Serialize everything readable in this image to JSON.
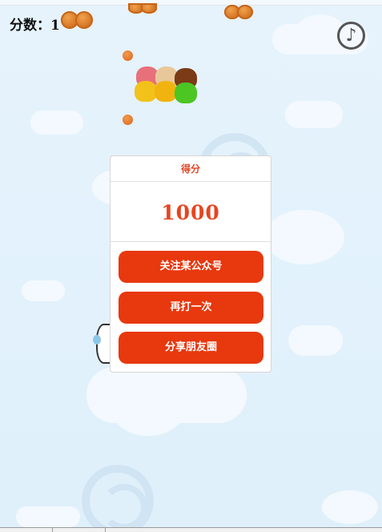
{
  "hud": {
    "score_label": "分数：",
    "score_value": "1",
    "music_icon": "music-note-icon",
    "music_glyph": "♪"
  },
  "result_panel": {
    "title": "得分",
    "score": "1000",
    "buttons": {
      "follow": "关注某公众号",
      "replay": "再打一次",
      "share": "分享朋友圈"
    }
  },
  "colors": {
    "accent": "#e8380d",
    "score_text": "#e84421",
    "sky": "#e3f1fb",
    "mooncake": "#d9731f"
  }
}
